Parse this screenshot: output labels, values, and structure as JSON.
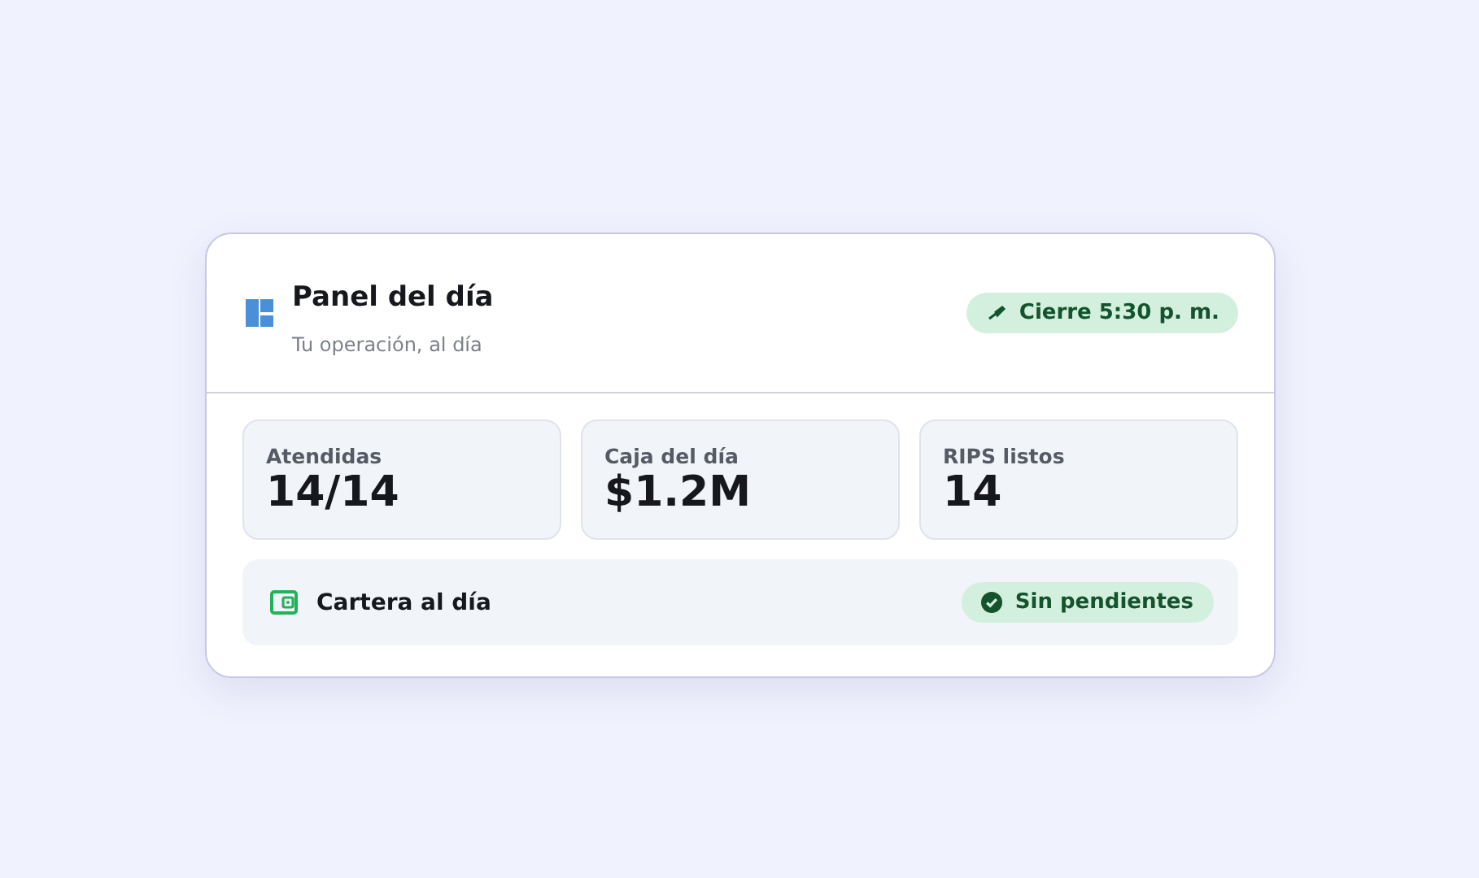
{
  "header": {
    "title": "Panel del día",
    "subtitle": "Tu operación, al día",
    "badge": "Cierre 5:30 p. m."
  },
  "stats": [
    {
      "label": "Atendidas",
      "value": "14/14"
    },
    {
      "label": "Caja del día",
      "value": "$1.2M"
    },
    {
      "label": "RIPS listos",
      "value": "14"
    }
  ],
  "footer": {
    "label": "Cartera al día",
    "status": "Sin pendientes"
  }
}
